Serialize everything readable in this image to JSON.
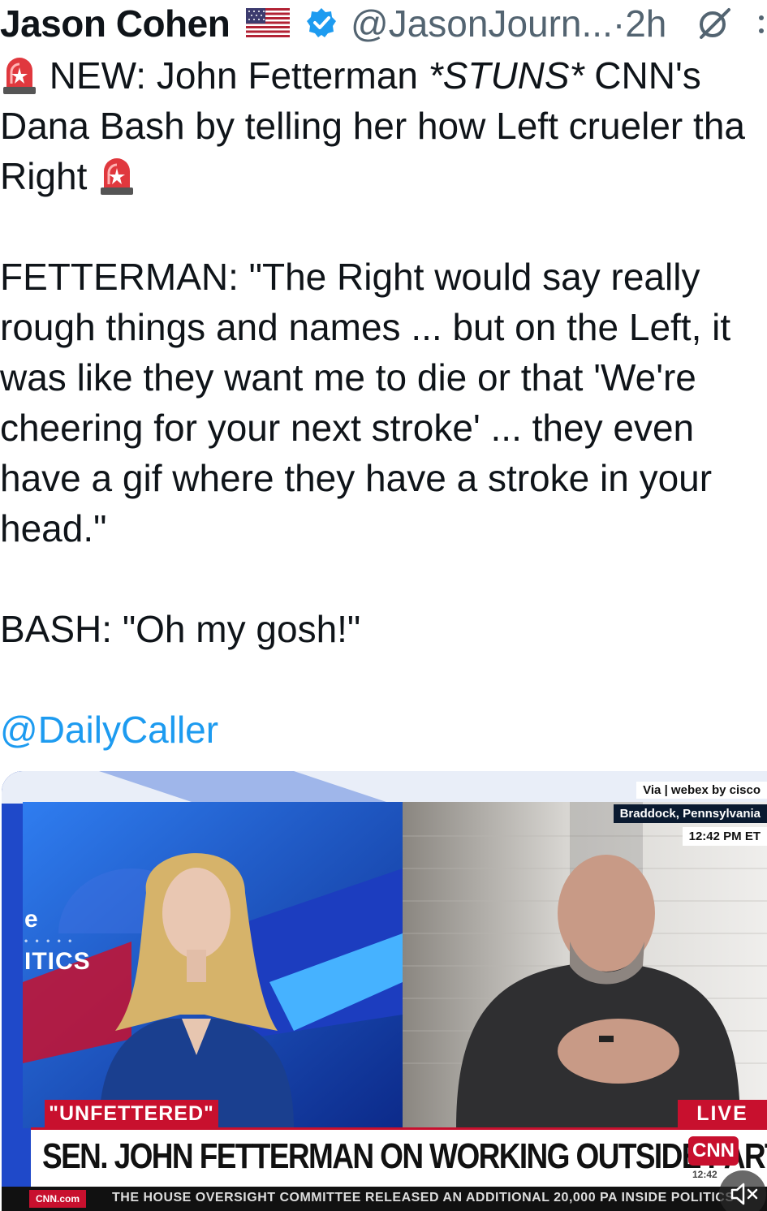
{
  "author": {
    "name": "Jason Cohen",
    "handle": "@JasonJourn...",
    "separator": "·",
    "time": "2h",
    "flag_icon": "us-flag-icon",
    "verified_icon": "verified-badge-icon",
    "verified_color": "#1d9bf0"
  },
  "tweet": {
    "line1_a": "NEW: John Fetterman ",
    "line1_b": "*STUNS*",
    "line1_c": " CNN's",
    "line2": "Dana Bash by telling her how Left crueler tha",
    "line3": "Right",
    "line4": "FETTERMAN: \"The Right would say really",
    "line5": "rough things and names ... but on the Left, it",
    "line6": "was like they want me to die or that 'We're",
    "line7": "cheering for your next stroke' ... they even",
    "line8": "have a gif where they have a stroke in your",
    "line9": "head.\"",
    "line10": "BASH: \"Oh my gosh!\"",
    "mention": "@DailyCaller",
    "mention_color": "#1d9bf0",
    "siren_icon": "police-siren-emoji"
  },
  "video": {
    "via": "Via | webex by cisco",
    "location": "Braddock, Pennsylvania",
    "time_overlay": "12:42 PM ET",
    "show_name_top": "e",
    "show_name": "ITICS",
    "label_left": "\"UNFETTERED\"",
    "label_live": "LIVE",
    "chyron": "SEN. JOHN FETTERMAN ON WORKING OUTSIDE PARTY LINES",
    "network_logo": "CNN",
    "chyron_time": "12:42",
    "ticker": "THE HOUSE OVERSIGHT COMMITTEE RELEASED AN ADDITIONAL 20,000 PA",
    "ticker_segment": "INSIDE POLITICS",
    "ticker_logo": "CNN.com",
    "brand_red": "#c8102e"
  },
  "controls": {
    "mute_icon": "speaker-muted-icon",
    "grok_icon": "grok-icon",
    "more_icon": "more-options-icon"
  }
}
